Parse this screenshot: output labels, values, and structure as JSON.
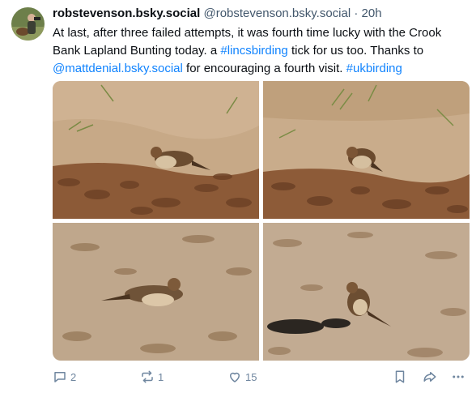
{
  "post": {
    "author": "robstevenson.bsky.social",
    "handle": "@robstevenson.bsky.social",
    "separator": "·",
    "time": "20h",
    "text": {
      "part1": "At last, after three failed attempts, it was fourth time lucky with the Crook Bank Lapland Bunting today. a ",
      "hashtag1": "#lincsbirding",
      "part2": " tick for us too. Thanks to ",
      "mention": "@mattdenial.bsky.social",
      "part3": " for encouraging a fourth visit. ",
      "hashtag2": "#ukbirding"
    }
  },
  "images": [
    {
      "icon": "photo-bunting-on-leaves-1"
    },
    {
      "icon": "photo-bunting-on-leaves-2"
    },
    {
      "icon": "photo-bunting-on-sand-1"
    },
    {
      "icon": "photo-bunting-on-sand-2"
    }
  ],
  "actions": {
    "reply_count": "2",
    "repost_count": "1",
    "like_count": "15"
  },
  "colors": {
    "link": "#1083fe",
    "muted": "#42576c",
    "icon": "#6f869f"
  }
}
